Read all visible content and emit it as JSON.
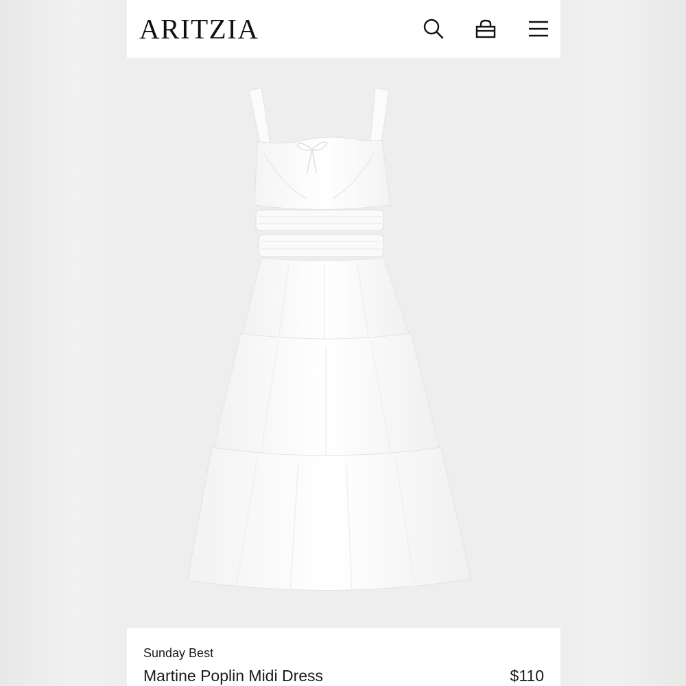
{
  "header": {
    "logo": "ARITZIA",
    "icons": [
      "search-icon",
      "shopping-bag-icon",
      "hamburger-menu-icon"
    ]
  },
  "product": {
    "image": "white-tiered-poplin-midi-dress",
    "brand": "Sunday Best",
    "name": "Martine Poplin Midi Dress",
    "price": "$110"
  },
  "colors": {
    "image_background": "#eeeeee",
    "text": "#1a1a1a"
  }
}
